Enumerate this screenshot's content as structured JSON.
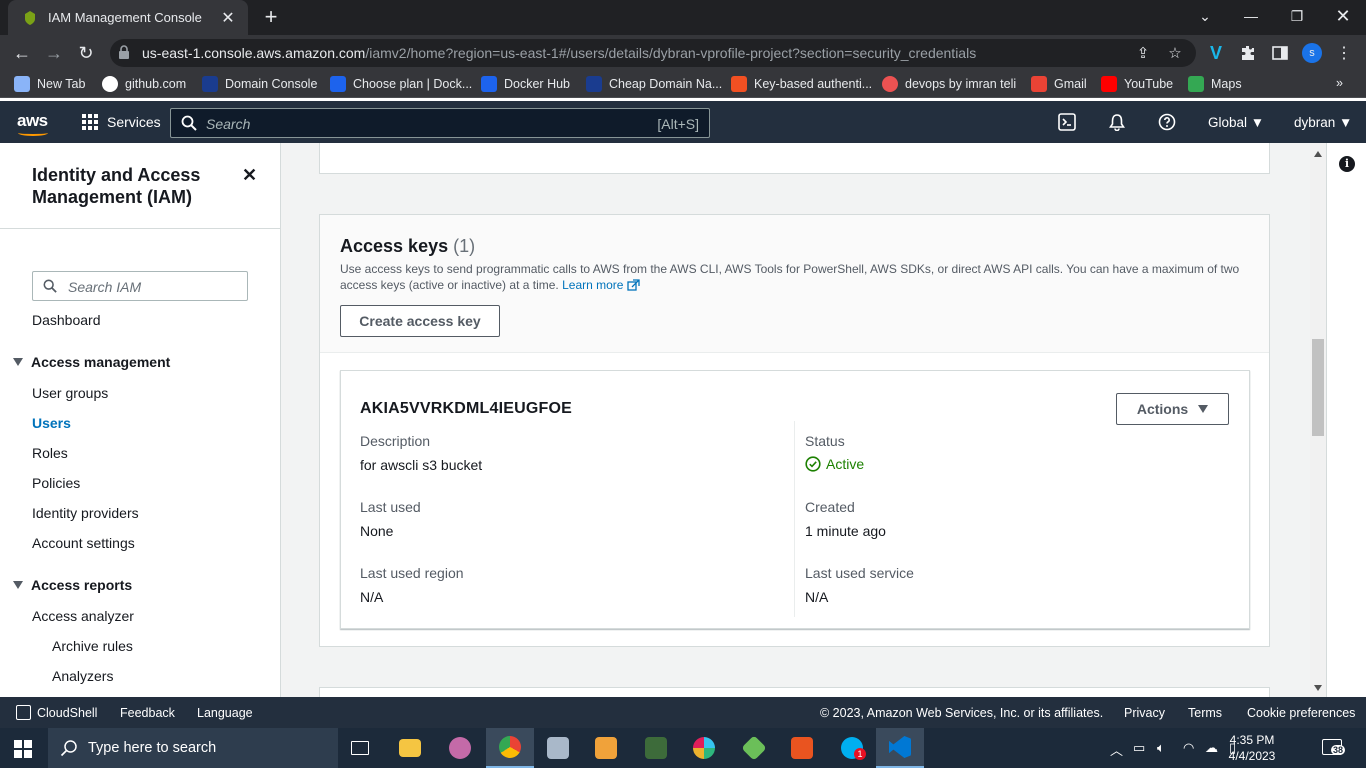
{
  "browser": {
    "tab_title": "IAM Management Console",
    "url_host": "us-east-1.console.aws.amazon.com",
    "url_path": "/iamv2/home?region=us-east-1#/users/details/dybran-vprofile-project?section=security_credentials",
    "profile_initial": "s",
    "bookmarks": [
      {
        "label": "New Tab",
        "icon": "new-tab-icon",
        "color": "#8ab4f8"
      },
      {
        "label": "github.com",
        "icon": "github-icon",
        "color": "#ffffff"
      },
      {
        "label": "Domain Console",
        "icon": "domain-console-icon",
        "color": "#1a3c8f"
      },
      {
        "label": "Choose plan | Dock...",
        "icon": "docker-icon",
        "color": "#1d63ed"
      },
      {
        "label": "Docker Hub",
        "icon": "docker-hub-icon",
        "color": "#1d63ed"
      },
      {
        "label": "Cheap Domain Na...",
        "icon": "namecheap-icon",
        "color": "#1a3c8f"
      },
      {
        "label": "Key-based authenti...",
        "icon": "microsoft-icon",
        "color": "#f25022"
      },
      {
        "label": "devops by imran teli",
        "icon": "udemy-icon",
        "color": "#ec5252"
      },
      {
        "label": "Gmail",
        "icon": "gmail-icon",
        "color": "#ea4335"
      },
      {
        "label": "YouTube",
        "icon": "youtube-icon",
        "color": "#ff0000"
      },
      {
        "label": "Maps",
        "icon": "maps-icon",
        "color": "#34a853"
      }
    ]
  },
  "aws_header": {
    "logo": "aws",
    "services_label": "Services",
    "search_placeholder": "Search",
    "search_shortcut": "[Alt+S]",
    "region_label": "Global",
    "account_label": "dybran"
  },
  "sidebar": {
    "title": "Identity and Access Management (IAM)",
    "search_placeholder": "Search IAM",
    "dashboard": "Dashboard",
    "access_management": {
      "heading": "Access management",
      "items": [
        "User groups",
        "Users",
        "Roles",
        "Policies",
        "Identity providers",
        "Account settings"
      ],
      "active": "Users"
    },
    "access_reports": {
      "heading": "Access reports",
      "items": [
        "Access analyzer"
      ],
      "subitems": [
        "Archive rules",
        "Analyzers"
      ]
    }
  },
  "access_keys": {
    "title": "Access keys",
    "count": "(1)",
    "description": "Use access keys to send programmatic calls to AWS from the AWS CLI, AWS Tools for PowerShell, AWS SDKs, or direct AWS API calls. You can have a maximum of two access keys (active or inactive) at a time.",
    "learn_more": "Learn more",
    "create_button": "Create access key",
    "key": {
      "id": "AKIA5VVRKDML4IEUGFOE",
      "actions_label": "Actions",
      "description_label": "Description",
      "description_value": "for awscli s3 bucket",
      "status_label": "Status",
      "status_value": "Active",
      "last_used_label": "Last used",
      "last_used_value": "None",
      "created_label": "Created",
      "created_value": "1 minute ago",
      "last_used_region_label": "Last used region",
      "last_used_region_value": "N/A",
      "last_used_service_label": "Last used service",
      "last_used_service_value": "N/A"
    }
  },
  "aws_footer": {
    "cloudshell": "CloudShell",
    "feedback": "Feedback",
    "language": "Language",
    "copyright": "© 2023, Amazon Web Services, Inc. or its affiliates.",
    "privacy": "Privacy",
    "terms": "Terms",
    "cookies": "Cookie preferences"
  },
  "taskbar": {
    "search_placeholder": "Type here to search",
    "time": "4:35 PM",
    "date": "4/4/2023",
    "notification_count": "38",
    "slack_badge": "1"
  },
  "colors": {
    "aws_nav": "#232f3e",
    "link_blue": "#0073bb",
    "status_green": "#1d8102",
    "aws_orange": "#ff9900"
  }
}
